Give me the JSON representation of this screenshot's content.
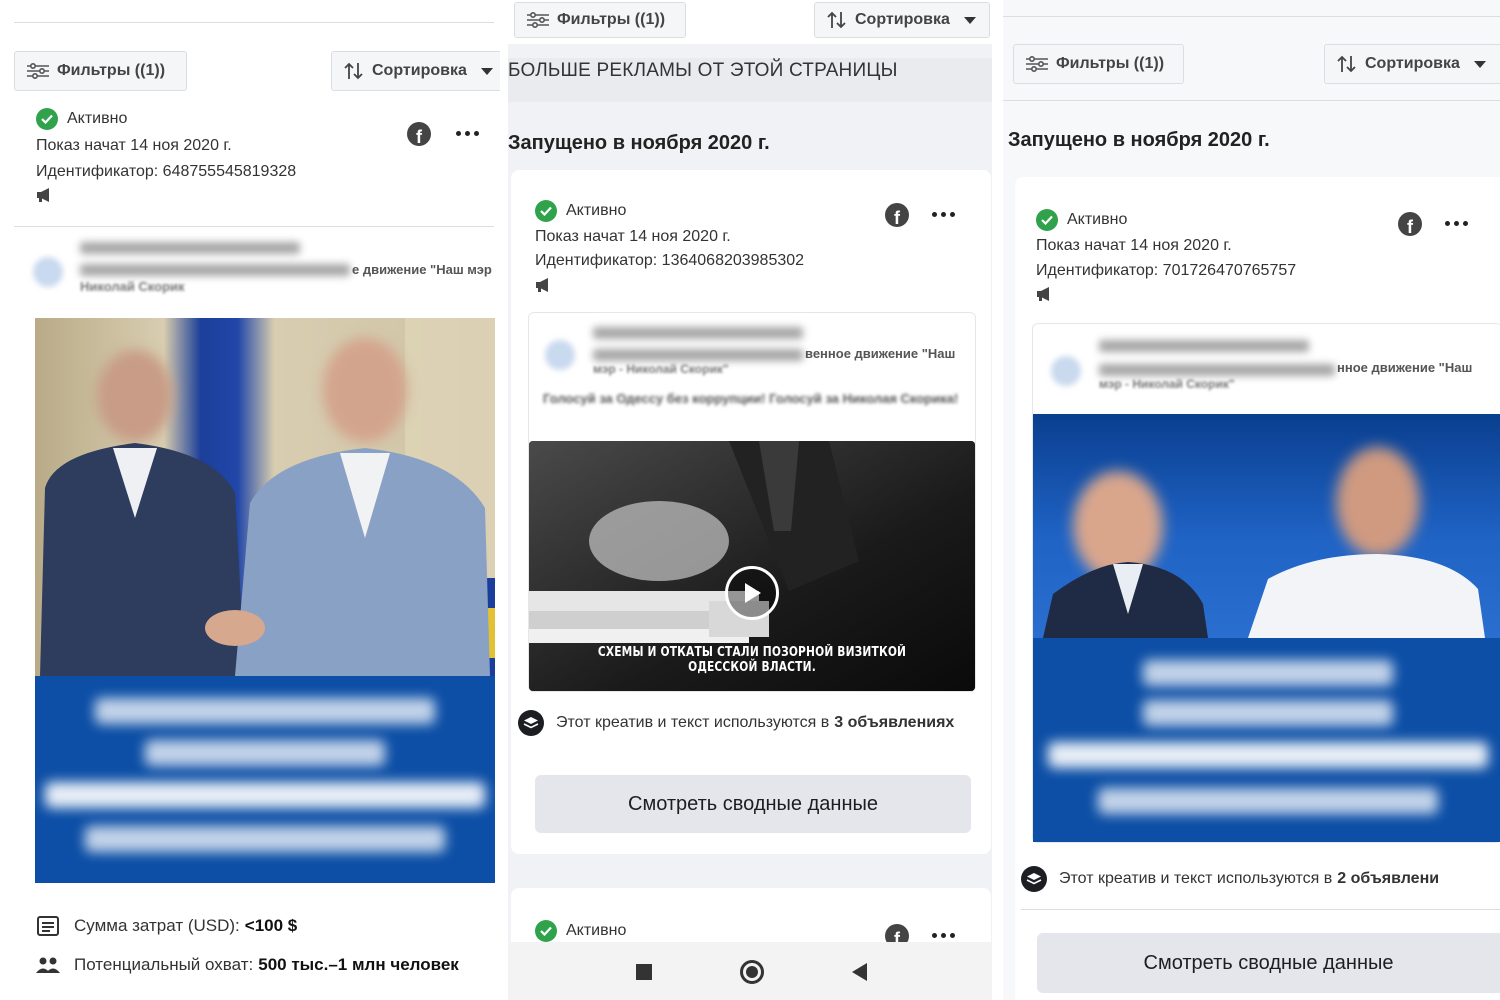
{
  "toolbar": {
    "filters_label": "Фильтры ((1))",
    "sort_label": "Сортировка"
  },
  "panel1": {
    "ad": {
      "status": "Активно",
      "started": "Показ начат 14 ноя 2020 г.",
      "id": "Идентификатор: 648755545819328"
    },
    "page_name_partial": "е движение \"Наш мэр",
    "page_name_line2": "Николай Скорик",
    "banner_text": [
      "Сергей Кивалов",
      "поддерживает",
      "Николая Скорика",
      "на выборах мэра"
    ],
    "spend_label": "Сумма затрат (USD):",
    "spend_value": "<100 $",
    "reach_label": "Потенциальный охват:",
    "reach_value": "500 тыс.–1 млн человек"
  },
  "panel2": {
    "more_ads": "БОЛЬШЕ РЕКЛАМЫ ОТ ЭТОЙ СТРАНИЦЫ",
    "section_title": "Запущено в ноября 2020 г.",
    "ad": {
      "status": "Активно",
      "started": "Показ начат 14 ноя 2020 г.",
      "id": "Идентификатор: 1364068203985302"
    },
    "page_name_partial": "венное движение \"Наш",
    "page_name_line2": "мэр - Николай Скорик\"",
    "post_text": "Голосуй за Одессу без коррупции! Голосуй за Николая Скорика!",
    "video_caption": "СХЕМЫ И ОТКАТЫ СТАЛИ ПОЗОРНОЙ ВИЗИТКОЙ ОДЕССКОЙ ВЛАСТИ.",
    "used_prefix": "Этот креатив и текст используются в",
    "used_count": "3 объявлениях",
    "summary_button": "Смотреть сводные данные",
    "next_status": "Активно"
  },
  "panel3": {
    "section_title": "Запущено в ноября 2020 г.",
    "ad": {
      "status": "Активно",
      "started": "Показ начат 14 ноя 2020 г.",
      "id": "Идентификатор: 701726470765757"
    },
    "page_name_partial": "нное движение \"Наш",
    "page_name_line2": "мэр - Николай Скорик\"",
    "banner_text": [
      "Юрий Бойко",
      "поддерживает",
      "Николая Скорика",
      "на выборах мэра"
    ],
    "used_prefix": "Этот креатив и текст используются в",
    "used_count": "2 объявлени",
    "summary_button": "Смотреть сводные данные"
  },
  "colors": {
    "active_green": "#31a24c",
    "banner_blue": "#0d4fa6",
    "button_gray": "#e4e6eb"
  }
}
